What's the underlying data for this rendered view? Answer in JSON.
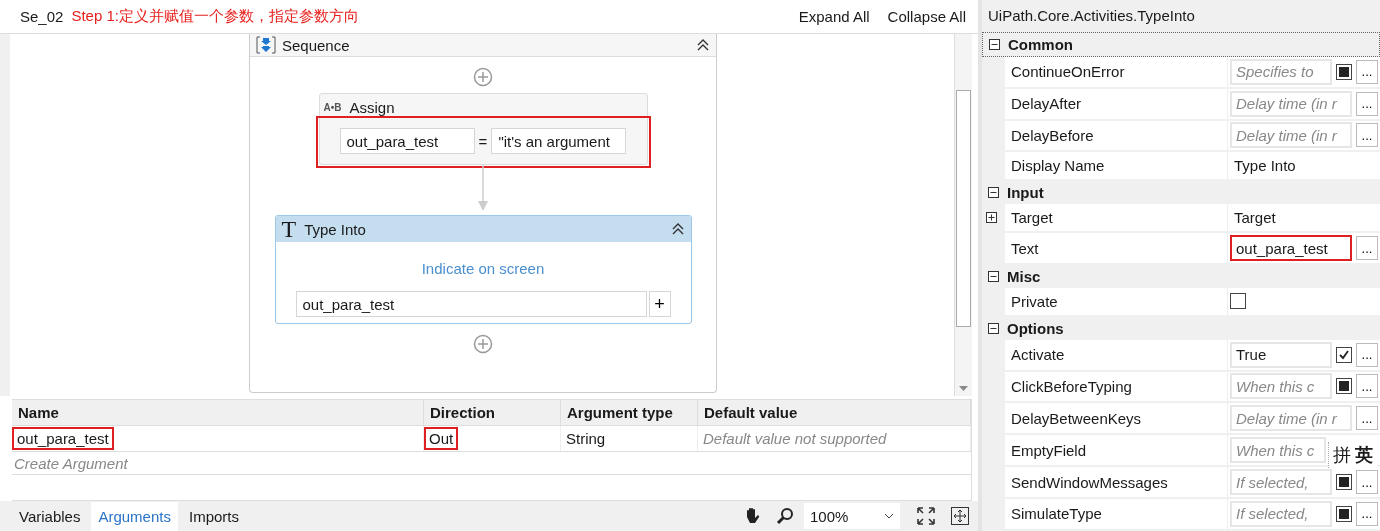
{
  "designer": {
    "title": "Se_02",
    "annotation": "Step 1:定义并赋值一个参数，指定参数方向",
    "actions": [
      "Expand All",
      "Collapse All"
    ],
    "sequence": {
      "title": "Sequence"
    },
    "assign": {
      "icon_text": "A•B",
      "title": "Assign",
      "to": "out_para_test",
      "equals": "=",
      "value": "\"it's an argument",
      "highlighted": true
    },
    "type_into": {
      "icon_text": "T",
      "title": "Type Into",
      "selected": true,
      "indicate": "Indicate on screen",
      "text": "out_para_test",
      "add": "+"
    }
  },
  "arguments": {
    "columns": [
      "Name",
      "Direction",
      "Argument type",
      "Default value"
    ],
    "rows": [
      {
        "cells": [
          {
            "text": "out_para_test",
            "highlighted": true
          },
          {
            "text": "Out",
            "highlighted": true
          },
          {
            "text": "String",
            "highlighted": false
          },
          {
            "placeholder": "Default value not supported",
            "highlighted": false
          }
        ]
      }
    ],
    "create": "Create Argument"
  },
  "bottom_bar": {
    "tabs": [
      {
        "label": "Variables",
        "selected": false
      },
      {
        "label": "Arguments",
        "selected": true
      },
      {
        "label": "Imports",
        "selected": false
      }
    ],
    "zoom": "100%"
  },
  "properties": {
    "title": "UiPath.Core.Activities.TypeInto",
    "categories": [
      {
        "name": "Common",
        "expanded": true,
        "items": [
          {
            "name": "ContinueOnError",
            "kind": "field",
            "placeholder": "Specifies to",
            "checkbox": {
              "checked": false,
              "indeterminate": true
            },
            "ellipsis": "...",
            "highlighted": false
          },
          {
            "name": "DelayAfter",
            "kind": "field",
            "placeholder": "Delay time (in r",
            "ellipsis": "...",
            "highlighted": false
          },
          {
            "name": "DelayBefore",
            "kind": "field",
            "placeholder": "Delay time (in r",
            "ellipsis": "...",
            "highlighted": false
          },
          {
            "name": "Display Name",
            "kind": "text",
            "value": "Type Into"
          }
        ]
      },
      {
        "name": "Input",
        "expanded": true,
        "items": [
          {
            "name": "Target",
            "kind": "text",
            "value": "Target",
            "expanded": false
          },
          {
            "name": "Text",
            "kind": "field",
            "value": "out_para_test",
            "ellipsis": "...",
            "highlighted": true
          }
        ]
      },
      {
        "name": "Misc",
        "expanded": true,
        "items": [
          {
            "name": "Private",
            "kind": "checkbox",
            "checkbox": {
              "checked": false
            }
          }
        ]
      },
      {
        "name": "Options",
        "expanded": true,
        "items": [
          {
            "name": "Activate",
            "kind": "field",
            "value": "True",
            "checkbox": {
              "checked": true
            },
            "ellipsis": "...",
            "highlighted": false
          },
          {
            "name": "ClickBeforeTyping",
            "kind": "field",
            "placeholder": "When this c",
            "checkbox": {
              "checked": false,
              "indeterminate": true
            },
            "ellipsis": "...",
            "highlighted": false
          },
          {
            "name": "DelayBetweenKeys",
            "kind": "field",
            "placeholder": "Delay time (in r",
            "ellipsis": "...",
            "highlighted": false
          },
          {
            "name": "EmptyField",
            "kind": "field",
            "placeholder": "When this c",
            "highlighted": false
          },
          {
            "name": "SendWindowMessages",
            "kind": "field",
            "placeholder": "If selected,",
            "checkbox": {
              "checked": false,
              "indeterminate": true
            },
            "ellipsis": "...",
            "highlighted": false
          },
          {
            "name": "SimulateType",
            "kind": "field",
            "placeholder": "If selected,",
            "checkbox": {
              "checked": false,
              "indeterminate": true
            },
            "ellipsis": "...",
            "highlighted": false
          }
        ]
      }
    ]
  },
  "ime_toolbar": {
    "buttons": [
      "拼",
      "英"
    ]
  }
}
